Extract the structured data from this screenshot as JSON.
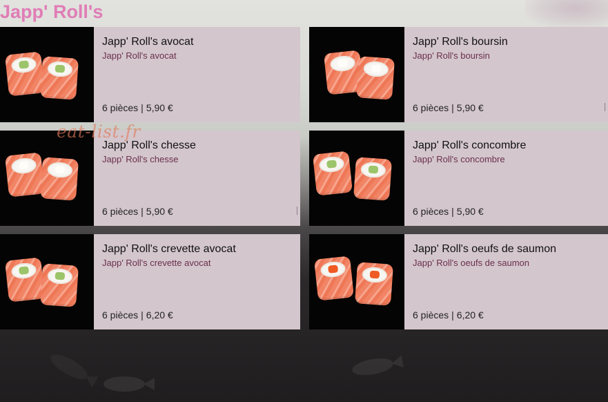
{
  "page": {
    "title": "Japp' Roll's",
    "watermark": "eat-list.fr"
  },
  "colors": {
    "title": "#e07db6",
    "card_background": "#d3c6cc",
    "subtitle": "#6a2f4d",
    "thumbnail_background": "#040404"
  },
  "items": [
    {
      "name": "Japp' Roll's avocat",
      "description": "Japp' Roll's avocat",
      "pieces": "6 pièces",
      "separator": "|",
      "price": "5,90 €",
      "filling": "green"
    },
    {
      "name": "Japp' Roll's boursin",
      "description": "Japp' Roll's boursin",
      "pieces": "6 pièces",
      "separator": "|",
      "price": "5,90 €",
      "filling": "white"
    },
    {
      "name": "Japp' Roll's chesse",
      "description": "Japp' Roll's chesse",
      "pieces": "6 pièces",
      "separator": "|",
      "price": "5,90 €",
      "filling": "white"
    },
    {
      "name": "Japp' Roll's concombre",
      "description": "Japp' Roll's concombre",
      "pieces": "6 pièces",
      "separator": "|",
      "price": "5,90 €",
      "filling": "green"
    },
    {
      "name": "Japp' Roll's crevette avocat",
      "description": "Japp' Roll's crevette avocat",
      "pieces": "6 pièces",
      "separator": "|",
      "price": "6,20 €",
      "filling": "green"
    },
    {
      "name": "Japp' Roll's oeufs de saumon",
      "description": "Japp' Roll's oeufs de saumon",
      "pieces": "6 pièces",
      "separator": "|",
      "price": "6,20 €",
      "filling": "orange"
    }
  ]
}
